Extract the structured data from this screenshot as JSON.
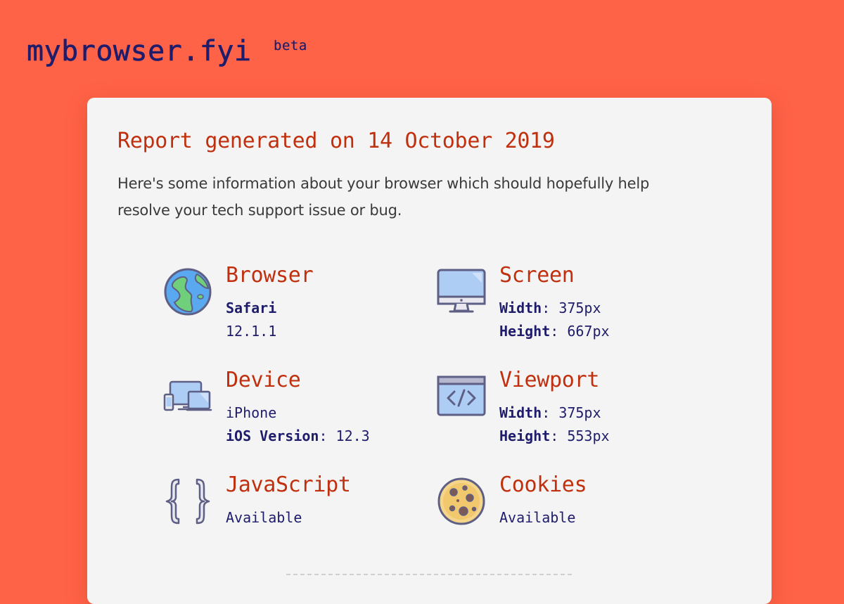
{
  "site": {
    "logo": "mybrowser.fyi",
    "badge": "beta"
  },
  "report": {
    "title": "Report generated on 14 October 2019",
    "intro": "Here's some information about your browser which should hopefully help resolve your tech support issue or bug."
  },
  "items": {
    "browser": {
      "label": "Browser",
      "name": "Safari",
      "version": "12.1.1",
      "icon": "globe-icon"
    },
    "screen": {
      "label": "Screen",
      "width_label": "Width",
      "width_value": "375px",
      "height_label": "Height",
      "height_value": "667px",
      "icon": "monitor-icon"
    },
    "device": {
      "label": "Device",
      "name": "iPhone",
      "os_label": "iOS Version",
      "os_value": "12.3",
      "icon": "devices-icon"
    },
    "viewport": {
      "label": "Viewport",
      "width_label": "Width",
      "width_value": "375px",
      "height_label": "Height",
      "height_value": "553px",
      "icon": "code-window-icon"
    },
    "javascript": {
      "label": "JavaScript",
      "status": "Available",
      "icon": "curly-braces-icon"
    },
    "cookies": {
      "label": "Cookies",
      "status": "Available",
      "icon": "cookie-icon"
    }
  },
  "colors": {
    "background": "#ff6347",
    "card": "#f4f4f4",
    "accent": "#c0300e",
    "ink": "#1f1d6b"
  }
}
